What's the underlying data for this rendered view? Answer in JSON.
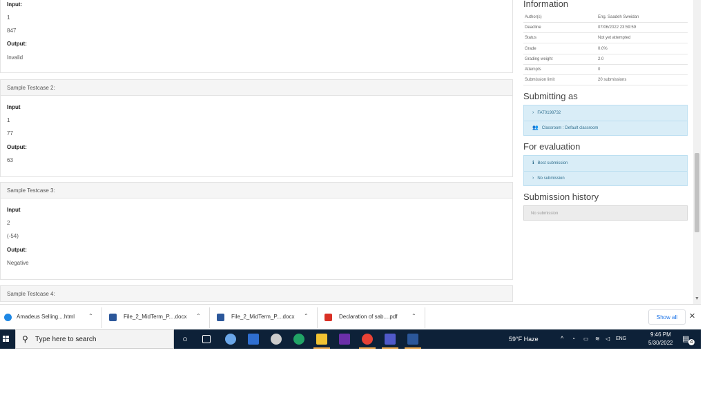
{
  "testcases": {
    "case1": {
      "input_label": "Input:",
      "input_values": [
        "1",
        "847"
      ],
      "output_label": "Output:",
      "output_value": "Invalid"
    },
    "case2": {
      "title": "Sample Testcase 2:",
      "input_label": "Input",
      "input_values": [
        "1",
        "77"
      ],
      "output_label": "Output:",
      "output_value": "63"
    },
    "case3": {
      "title": "Sample Testcase 3:",
      "input_label": "Input",
      "input_values": [
        "2",
        "(-54)"
      ],
      "output_label": "Output:",
      "output_value": "Negative"
    },
    "case4": {
      "title": "Sample Testcase 4:"
    }
  },
  "information": {
    "title": "Information",
    "rows": [
      {
        "key": "Author(s)",
        "value": "Eng. Saadeh Sweidan"
      },
      {
        "key": "Deadline",
        "value": "07/06/2022 23:59:59"
      },
      {
        "key": "Status",
        "value": "Not yet attempted"
      },
      {
        "key": "Grade",
        "value": "0.0%"
      },
      {
        "key": "Grading weight",
        "value": "2.0"
      },
      {
        "key": "Attempts",
        "value": "0"
      },
      {
        "key": "Submission limit",
        "value": "20 submissions"
      }
    ]
  },
  "submitting_as": {
    "title": "Submitting as",
    "user": "FAT0198732",
    "classroom": "Classroom : Default classroom"
  },
  "for_evaluation": {
    "title": "For evaluation",
    "best": "Best submission",
    "none": "No submission"
  },
  "submission_history": {
    "title": "Submission history",
    "empty": "No submission"
  },
  "downloads": {
    "items": [
      {
        "name": "Amadeus Selling....html",
        "icon": "edge-html-icon",
        "color": "#1e88e5"
      },
      {
        "name": "File_2_MidTerm_P....docx",
        "icon": "word-doc-icon",
        "color": "#2b579a"
      },
      {
        "name": "File_2_MidTerm_P....docx",
        "icon": "word-doc-icon",
        "color": "#2b579a"
      },
      {
        "name": "Declaration of sab....pdf",
        "icon": "pdf-icon",
        "color": "#d93025"
      }
    ],
    "show_all": "Show all"
  },
  "taskbar": {
    "search_placeholder": "Type here to search",
    "weather": "59°F  Haze",
    "time": "9:46 PM",
    "date": "5/30/2022",
    "notifications": "4",
    "lang": "ENG"
  }
}
